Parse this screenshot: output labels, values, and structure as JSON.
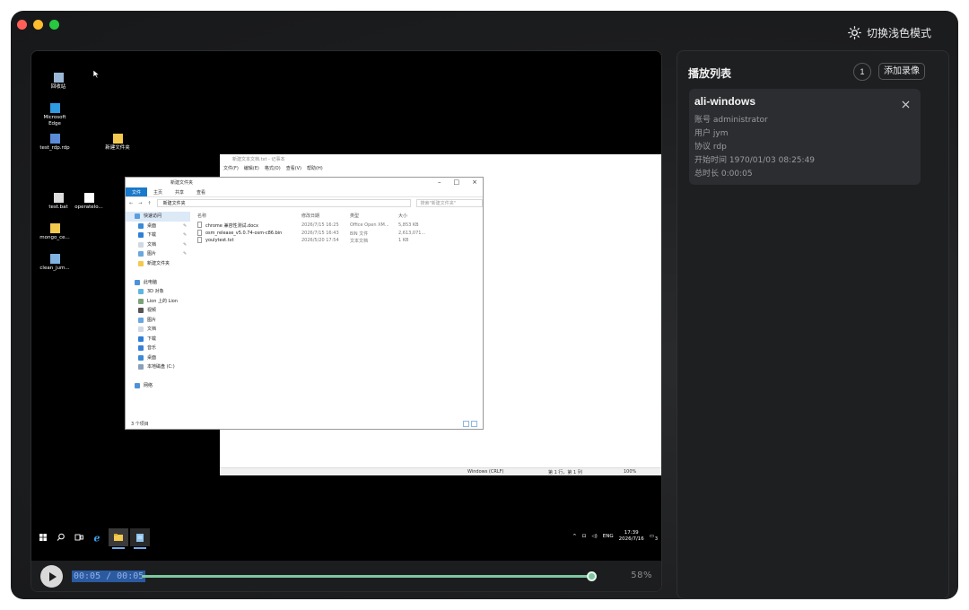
{
  "window": {
    "controls": [
      "close",
      "minimize",
      "maximize"
    ]
  },
  "header": {
    "theme_toggle": "切换浅色模式",
    "theme_icon": "sun-icon"
  },
  "player": {
    "time_label": "00:05 / 00:05",
    "progress_fraction": 0.99,
    "zoom": "58%",
    "desktop": {
      "icons": [
        {
          "name": "recycle-bin",
          "label": "回收站",
          "color": "#9ab8d6"
        },
        {
          "name": "edge",
          "label": "Microsoft\nEdge",
          "color": "#2f9be0"
        },
        {
          "name": "rdp-file",
          "label": "test_rdp.rdp",
          "color": "#5a8ad8"
        },
        {
          "name": "new-folder",
          "label": "新建文件夹",
          "color": "#f3c94f"
        },
        {
          "name": "bat-file",
          "label": "test.bat",
          "color": "#dddddd"
        },
        {
          "name": "text-file",
          "label": "operatelo...",
          "color": "#ffffff"
        },
        {
          "name": "mongo-folder",
          "label": "mongo_ce...",
          "color": "#f3c94f"
        },
        {
          "name": "clean-file",
          "label": "clean_jum...",
          "color": "#7fb2e0"
        }
      ],
      "notepad": {
        "title": "新建文本文档.txt - 记事本",
        "menu": [
          "文件(F)",
          "编辑(E)",
          "格式(O)",
          "查看(V)",
          "帮助(H)"
        ],
        "status_encoding": "Windows (CRLF)",
        "status_position": "第 1 行，第 1 列",
        "status_zoom": "100%"
      },
      "explorer": {
        "title": "新建文件夹",
        "ribbon": [
          "文件",
          "主页",
          "共享",
          "查看"
        ],
        "address": "新建文件夹",
        "search_placeholder": "搜索\"新建文件夹\"",
        "nav": [
          {
            "label": "快速访问",
            "color": "#5a9ee0",
            "selected": true
          },
          {
            "label": "桌面",
            "color": "#3b8ad8",
            "pin": true
          },
          {
            "label": "下载",
            "color": "#2f7ed8",
            "pin": true
          },
          {
            "label": "文档",
            "color": "#cfd8e3",
            "pin": true
          },
          {
            "label": "图片",
            "color": "#6aa7e0",
            "pin": true
          },
          {
            "label": "新建文件夹",
            "color": "#f3c94f"
          },
          {
            "label": "",
            "color": ""
          },
          {
            "label": "此电脑",
            "color": "#4d92d8"
          },
          {
            "label": "3D 对象",
            "color": "#5fb5e0"
          },
          {
            "label": "Lion 上的 Lion",
            "color": "#7aa37a"
          },
          {
            "label": "视频",
            "color": "#555555"
          },
          {
            "label": "图片",
            "color": "#6aa7e0"
          },
          {
            "label": "文档",
            "color": "#cfd8e3"
          },
          {
            "label": "下载",
            "color": "#2f7ed8"
          },
          {
            "label": "音乐",
            "color": "#3a7fd8"
          },
          {
            "label": "桌面",
            "color": "#3b8ad8"
          },
          {
            "label": "本地磁盘 (C:)",
            "color": "#8aa0b8"
          },
          {
            "label": "",
            "color": ""
          },
          {
            "label": "网络",
            "color": "#4d92d8"
          }
        ],
        "columns": [
          "名称",
          "修改日期",
          "类型",
          "大小"
        ],
        "files": [
          {
            "name": "chrome 兼容性测试.docx",
            "date": "2026/7/15 16:25",
            "type": "Office Open XM...",
            "size": "5,853 KB"
          },
          {
            "name": "osm_release_v5.0.74-osm-c86.bin",
            "date": "2026/7/15 16:43",
            "type": "BIN 文件",
            "size": "2,613,071..."
          },
          {
            "name": "youlytest.txt",
            "date": "2026/5/20 17:54",
            "type": "文本文档",
            "size": "1 KB"
          }
        ],
        "status": "3 个项目"
      },
      "taskbar": {
        "items": [
          "windows-start-icon",
          "search-icon",
          "task-view-icon",
          "ie-icon",
          "file-explorer-icon",
          "notepad-icon"
        ],
        "tray_text": "ENG",
        "clock_time": "17:39",
        "clock_date": "2026/7/16",
        "notification_count": "3"
      }
    }
  },
  "playlist": {
    "title": "播放列表",
    "count": "1",
    "add_label": "添加录像",
    "items": [
      {
        "title": "ali-windows",
        "account": "账号 administrator",
        "user": "用户 jym",
        "protocol": "协议 rdp",
        "start": "开始时间 1970/01/03 08:25:49",
        "duration": "总时长 0:00:05"
      }
    ]
  },
  "colors": {
    "accent": "#7ec8a0",
    "background": "#1d1e20",
    "card": "#2c2d30"
  }
}
